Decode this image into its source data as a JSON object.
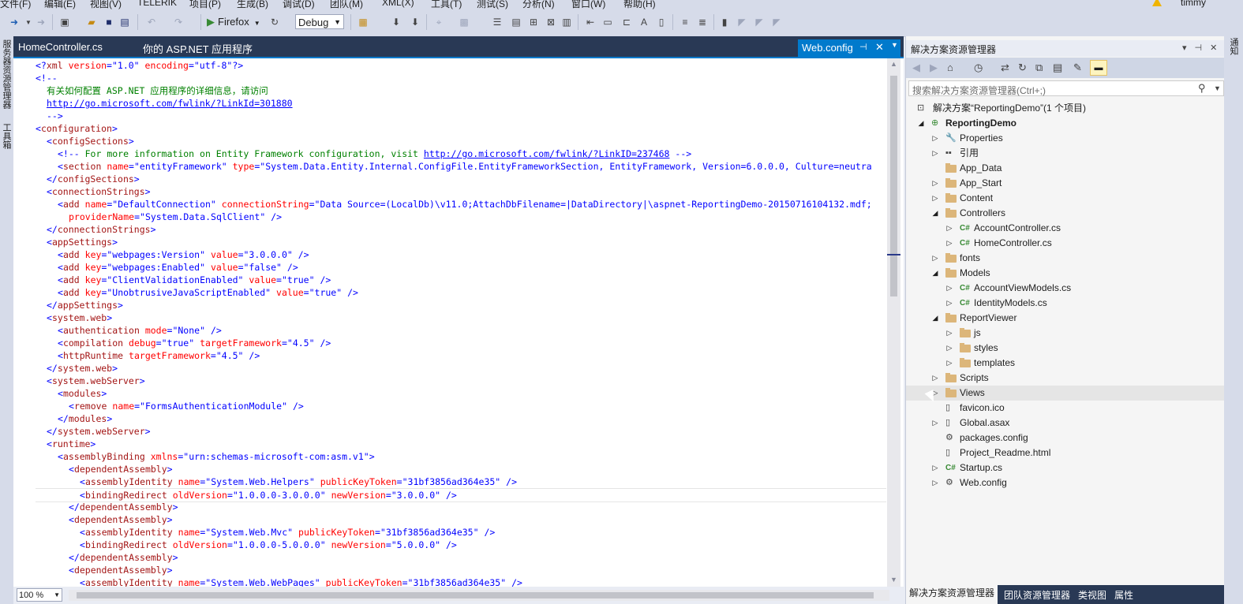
{
  "menu": {
    "items": [
      "文件(F)",
      "编辑(E)",
      "视图(V)",
      "TELERIK",
      "项目(P)",
      "生成(B)",
      "调试(D)",
      "团队(M)",
      "XML(X)",
      "工具(T)",
      "测试(S)",
      "分析(N)",
      "窗口(W)",
      "帮助(H)"
    ],
    "user": "timmy"
  },
  "toolbar": {
    "run_label": "Firefox",
    "config_value": "Debug"
  },
  "left_strip": {
    "label1": "服务器资源管理器",
    "label2": "工具箱"
  },
  "right_strip": {
    "label": "通知"
  },
  "editor_tabs": {
    "tab1": "HomeController.cs",
    "tab2": "你的 ASP.NET 应用程序",
    "active": "Web.config"
  },
  "editor": {
    "zoom": "100 %",
    "lines": [
      {
        "indent": 0,
        "fold": "",
        "text": "<?xml version=\"1.0\" encoding=\"utf-8\"?>"
      },
      {
        "indent": 0,
        "fold": "-",
        "text": "<!--"
      },
      {
        "indent": 1,
        "fold": "",
        "text": "有关如何配置 ASP.NET 应用程序的详细信息，请访问"
      },
      {
        "indent": 1,
        "fold": "",
        "text": "http://go.microsoft.com/fwlink/?LinkId=301880"
      },
      {
        "indent": 1,
        "fold": "",
        "text": "-->"
      },
      {
        "indent": 0,
        "fold": "-",
        "text": "<configuration>"
      },
      {
        "indent": 1,
        "fold": "-",
        "text": "<configSections>"
      },
      {
        "indent": 2,
        "fold": "",
        "text": "<!-- For more information on Entity Framework configuration, visit http://go.microsoft.com/fwlink/?LinkID=237468 -->"
      },
      {
        "indent": 2,
        "fold": "",
        "text": "<section name=\"entityFramework\" type=\"System.Data.Entity.Internal.ConfigFile.EntityFrameworkSection, EntityFramework, Version=6.0.0.0, Culture=neutra"
      },
      {
        "indent": 1,
        "fold": "",
        "text": "</configSections>"
      },
      {
        "indent": 1,
        "fold": "-",
        "text": "<connectionStrings>"
      },
      {
        "indent": 2,
        "fold": "",
        "text": "<add name=\"DefaultConnection\" connectionString=\"Data Source=(LocalDb)\\v11.0;AttachDbFilename=|DataDirectory|\\aspnet-ReportingDemo-20150716104132.mdf;"
      },
      {
        "indent": 3,
        "fold": "",
        "text": "providerName=\"System.Data.SqlClient\" />"
      },
      {
        "indent": 1,
        "fold": "",
        "text": "</connectionStrings>"
      },
      {
        "indent": 1,
        "fold": "-",
        "text": "<appSettings>"
      },
      {
        "indent": 2,
        "fold": "",
        "text": "<add key=\"webpages:Version\" value=\"3.0.0.0\" />"
      },
      {
        "indent": 2,
        "fold": "",
        "text": "<add key=\"webpages:Enabled\" value=\"false\" />"
      },
      {
        "indent": 2,
        "fold": "",
        "text": "<add key=\"ClientValidationEnabled\" value=\"true\" />"
      },
      {
        "indent": 2,
        "fold": "",
        "text": "<add key=\"UnobtrusiveJavaScriptEnabled\" value=\"true\" />"
      },
      {
        "indent": 1,
        "fold": "",
        "text": "</appSettings>"
      },
      {
        "indent": 1,
        "fold": "-",
        "text": "<system.web>"
      },
      {
        "indent": 2,
        "fold": "",
        "text": "<authentication mode=\"None\" />"
      },
      {
        "indent": 2,
        "fold": "",
        "text": "<compilation debug=\"true\" targetFramework=\"4.5\" />"
      },
      {
        "indent": 2,
        "fold": "",
        "text": "<httpRuntime targetFramework=\"4.5\" />"
      },
      {
        "indent": 1,
        "fold": "",
        "text": "</system.web>"
      },
      {
        "indent": 1,
        "fold": "-",
        "text": "<system.webServer>"
      },
      {
        "indent": 2,
        "fold": "-",
        "text": "<modules>"
      },
      {
        "indent": 3,
        "fold": "",
        "text": "<remove name=\"FormsAuthenticationModule\" />"
      },
      {
        "indent": 2,
        "fold": "",
        "text": "</modules>"
      },
      {
        "indent": 1,
        "fold": "",
        "text": "</system.webServer>"
      },
      {
        "indent": 1,
        "fold": "-",
        "text": "<runtime>"
      },
      {
        "indent": 2,
        "fold": "-",
        "text": "<assemblyBinding xmlns=\"urn:schemas-microsoft-com:asm.v1\">"
      },
      {
        "indent": 3,
        "fold": "-",
        "text": "<dependentAssembly>"
      },
      {
        "indent": 4,
        "fold": "",
        "text": "<assemblyIdentity name=\"System.Web.Helpers\" publicKeyToken=\"31bf3856ad364e35\" />"
      },
      {
        "indent": 4,
        "fold": "",
        "text": "<bindingRedirect oldVersion=\"1.0.0.0-3.0.0.0\" newVersion=\"3.0.0.0\" />",
        "current": true
      },
      {
        "indent": 3,
        "fold": "",
        "text": "</dependentAssembly>"
      },
      {
        "indent": 3,
        "fold": "-",
        "text": "<dependentAssembly>"
      },
      {
        "indent": 4,
        "fold": "",
        "text": "<assemblyIdentity name=\"System.Web.Mvc\" publicKeyToken=\"31bf3856ad364e35\" />"
      },
      {
        "indent": 4,
        "fold": "",
        "text": "<bindingRedirect oldVersion=\"1.0.0.0-5.0.0.0\" newVersion=\"5.0.0.0\" />"
      },
      {
        "indent": 3,
        "fold": "",
        "text": "</dependentAssembly>"
      },
      {
        "indent": 3,
        "fold": "-",
        "text": "<dependentAssembly>"
      },
      {
        "indent": 4,
        "fold": "",
        "text": "<assemblyIdentity name=\"System.Web.WebPages\" publicKeyToken=\"31bf3856ad364e35\" />"
      }
    ]
  },
  "solution_explorer": {
    "title": "解决方案资源管理器",
    "search_placeholder": "搜索解决方案资源管理器(Ctrl+;)",
    "tree": [
      {
        "level": 0,
        "exp": "",
        "icon": "solution",
        "label": "解决方案“ReportingDemo”(1 个项目)"
      },
      {
        "level": 0,
        "exp": "open",
        "icon": "project",
        "label": "ReportingDemo",
        "bold": true
      },
      {
        "level": 1,
        "exp": "closed",
        "icon": "wrench",
        "label": "Properties"
      },
      {
        "level": 1,
        "exp": "closed",
        "icon": "ref",
        "label": "引用"
      },
      {
        "level": 1,
        "exp": "",
        "icon": "folder",
        "label": "App_Data"
      },
      {
        "level": 1,
        "exp": "closed",
        "icon": "folder",
        "label": "App_Start"
      },
      {
        "level": 1,
        "exp": "closed",
        "icon": "folder",
        "label": "Content"
      },
      {
        "level": 1,
        "exp": "open",
        "icon": "folder",
        "label": "Controllers"
      },
      {
        "level": 2,
        "exp": "closed",
        "icon": "cs",
        "label": "AccountController.cs"
      },
      {
        "level": 2,
        "exp": "closed",
        "icon": "cs",
        "label": "HomeController.cs"
      },
      {
        "level": 1,
        "exp": "closed",
        "icon": "folder",
        "label": "fonts"
      },
      {
        "level": 1,
        "exp": "open",
        "icon": "folder",
        "label": "Models"
      },
      {
        "level": 2,
        "exp": "closed",
        "icon": "cs",
        "label": "AccountViewModels.cs"
      },
      {
        "level": 2,
        "exp": "closed",
        "icon": "cs",
        "label": "IdentityModels.cs"
      },
      {
        "level": 1,
        "exp": "open",
        "icon": "folder",
        "label": "ReportViewer"
      },
      {
        "level": 2,
        "exp": "closed",
        "icon": "folder",
        "label": "js"
      },
      {
        "level": 2,
        "exp": "closed",
        "icon": "folder",
        "label": "styles"
      },
      {
        "level": 2,
        "exp": "closed",
        "icon": "folder",
        "label": "templates"
      },
      {
        "level": 1,
        "exp": "closed",
        "icon": "folder",
        "label": "Scripts"
      },
      {
        "level": 1,
        "exp": "closed",
        "icon": "folder",
        "label": "Views",
        "selected": true
      },
      {
        "level": 1,
        "exp": "",
        "icon": "file",
        "label": "favicon.ico"
      },
      {
        "level": 1,
        "exp": "closed",
        "icon": "file",
        "label": "Global.asax"
      },
      {
        "level": 1,
        "exp": "",
        "icon": "config",
        "label": "packages.config"
      },
      {
        "level": 1,
        "exp": "",
        "icon": "file",
        "label": "Project_Readme.html"
      },
      {
        "level": 1,
        "exp": "closed",
        "icon": "cs",
        "label": "Startup.cs"
      },
      {
        "level": 1,
        "exp": "closed",
        "icon": "config",
        "label": "Web.config"
      }
    ],
    "bottom_tabs": [
      "解决方案资源管理器",
      "团队资源管理器",
      "类视图",
      "属性"
    ]
  }
}
